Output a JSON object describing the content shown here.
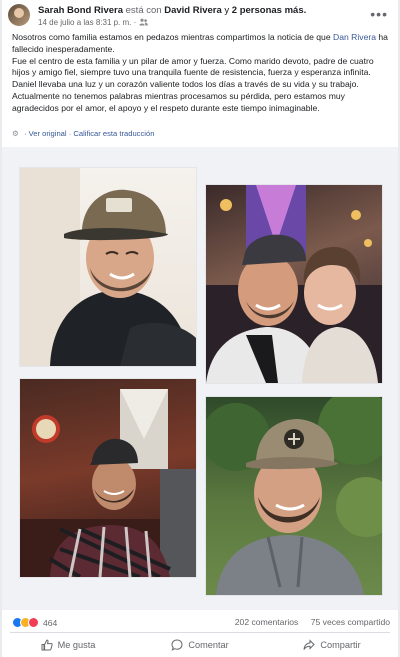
{
  "post": {
    "author": "Sarah Bond Rivera",
    "connector": "está con",
    "tagged": "David Rivera",
    "and_word": "y",
    "others": "2 personas más.",
    "timestamp": "14 de julio a las 8:31 p. m.",
    "separator": "·",
    "body_pre": "Nosotros como familia estamos en pedazos mientras compartimos la noticia de que",
    "mention": "Dan Rivera",
    "body_post": "ha fallecido inesperadamente.",
    "body_p2": "Fue el centro de esta familia y un pilar de amor y fuerza. Como marido devoto, padre de cuatro hijos y amigo fiel, siempre tuvo una tranquila fuente de resistencia, fuerza y esperanza infinita. Daniel llevaba una luz y un corazón valiente todos los días a través de su vida y su trabajo. Actualmente no tenemos palabras mientras procesamos su pérdida, pero estamos muy agradecidos por el amor, el apoyo y el respeto durante este tiempo inimaginable.",
    "see_original": "Ver original",
    "rate_translation": "Calificar esta traducción",
    "translate_sep": "·"
  },
  "stats": {
    "reaction_count": "464",
    "comments": "202 comentarios",
    "shares": "75 veces compartido"
  },
  "actions": {
    "like": "Me gusta",
    "comment": "Comentar",
    "share": "Compartir"
  },
  "colors": {
    "link": "#385898",
    "muted": "#65676b",
    "like_blue": "#1877f2"
  }
}
